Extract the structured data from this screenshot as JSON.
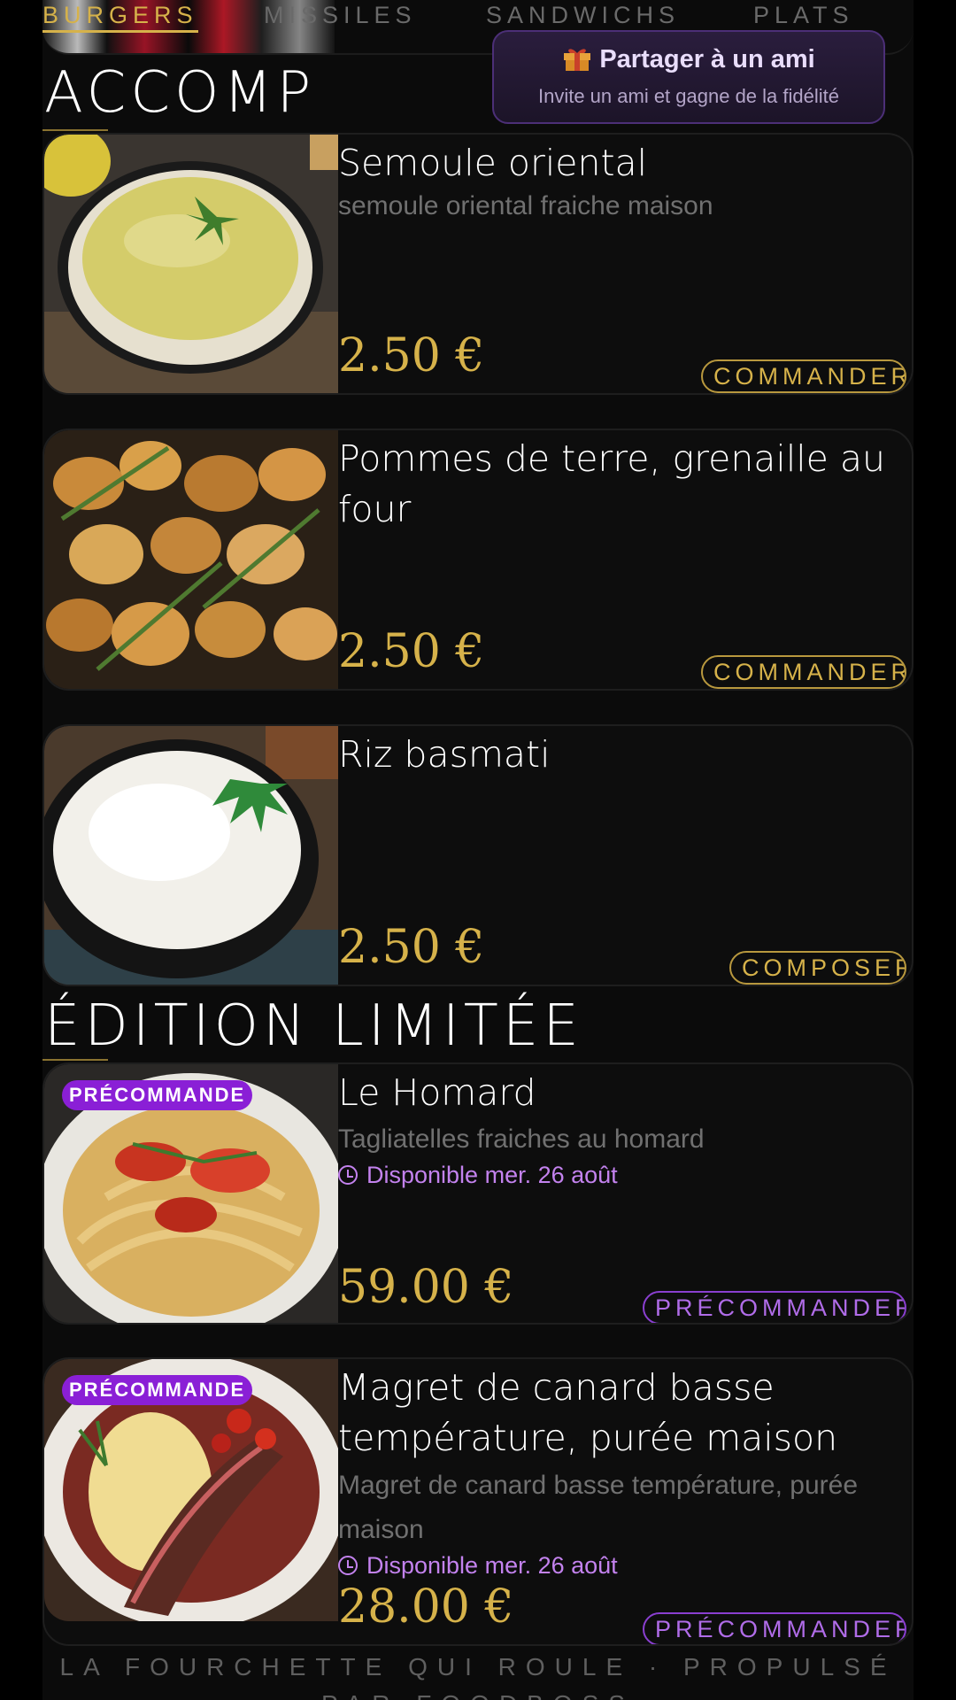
{
  "tabs": [
    {
      "label": "BURGERS",
      "active": true
    },
    {
      "label": "MISSILES",
      "active": false
    },
    {
      "label": "SANDWICHS",
      "active": false
    },
    {
      "label": "PLATS",
      "active": false
    }
  ],
  "share": {
    "icon": "gift-icon",
    "title": "Partager à un ami",
    "subtitle": "Invite un ami et gagne de la fidélité"
  },
  "sections": [
    {
      "title": "ACCOMP",
      "items": [
        {
          "name": "Semoule oriental",
          "description": "semoule oriental fraiche maison",
          "price": "2.50 €",
          "button": "COMMANDER",
          "image": "couscous-bowl"
        },
        {
          "name": "Pommes de terre, grenaille au four",
          "description": "",
          "price": "2.50 €",
          "button": "COMMANDER",
          "image": "roasted-potatoes"
        },
        {
          "name": "Riz basmati",
          "description": "",
          "price": "2.50 €",
          "button": "COMPOSER",
          "image": "rice-bowl"
        }
      ]
    },
    {
      "title": "ÉDITION LIMITÉE",
      "items": [
        {
          "name": "Le Homard",
          "description": "Tagliatelles fraiches au homard",
          "availability": "Disponible mer. 26 août",
          "price": "59.00 €",
          "button": "PRÉCOMMANDER",
          "badge": "PRÉCOMMANDE",
          "image": "lobster-pasta"
        },
        {
          "name": "Magret de canard basse température, purée maison",
          "description": "Magret de canard basse température, purée maison",
          "availability": "Disponible mer. 26 août",
          "price": "28.00 €",
          "button": "PRÉCOMMANDER",
          "badge": "PRÉCOMMANDE",
          "image": "duck-mash"
        }
      ]
    }
  ],
  "footer": "LA FOURCHETTE QUI ROULE · PROPULSÉ PAR FOODBOSS",
  "colors": {
    "background": "#000000",
    "gold": "#d6b24a",
    "purple": "#8a1fd6",
    "lavender": "#c382ee"
  }
}
